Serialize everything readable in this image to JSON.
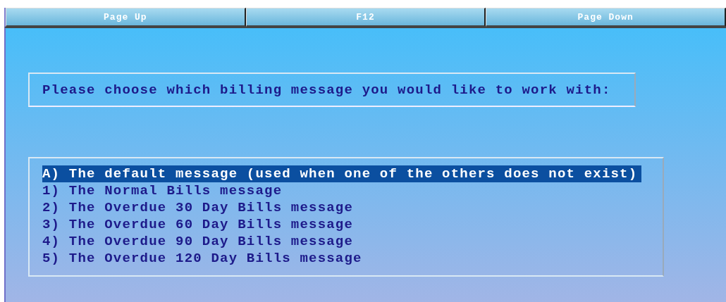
{
  "function_keys": [
    {
      "label": "Page Up"
    },
    {
      "label": "F12"
    },
    {
      "label": "Page Down"
    }
  ],
  "prompt": "Please choose which billing message you would like to work with:",
  "messages": [
    {
      "label": "A) The default message (used when one of the others does not exist)",
      "selected": true
    },
    {
      "label": "1) The Normal Bills message",
      "selected": false
    },
    {
      "label": "2) The Overdue 30 Day Bills message",
      "selected": false
    },
    {
      "label": "3) The Overdue 60 Day Bills message",
      "selected": false
    },
    {
      "label": "4) The Overdue 90 Day Bills message",
      "selected": false
    },
    {
      "label": "5) The Overdue 120 Day Bills message",
      "selected": false
    }
  ]
}
